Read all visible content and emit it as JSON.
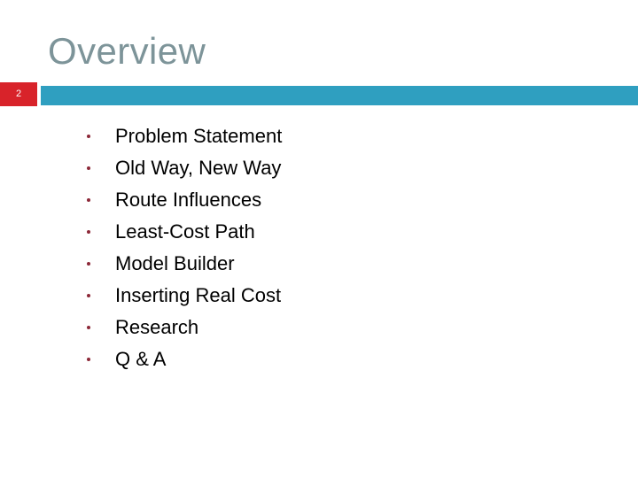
{
  "slide": {
    "title": "Overview",
    "number": "2",
    "accent_teal": "#2f9fc0",
    "accent_red": "#d8232a",
    "title_color": "#7d9499",
    "bullet_marker_color": "#8c2838",
    "background_color": "#ffffff"
  },
  "bullets": [
    {
      "text": "Problem Statement"
    },
    {
      "text": "Old Way, New Way"
    },
    {
      "text": "Route Influences"
    },
    {
      "text": "Least-Cost Path"
    },
    {
      "text": "Model Builder"
    },
    {
      "text": "Inserting Real Cost"
    },
    {
      "text": "Research"
    },
    {
      "text": "Q & A"
    }
  ]
}
